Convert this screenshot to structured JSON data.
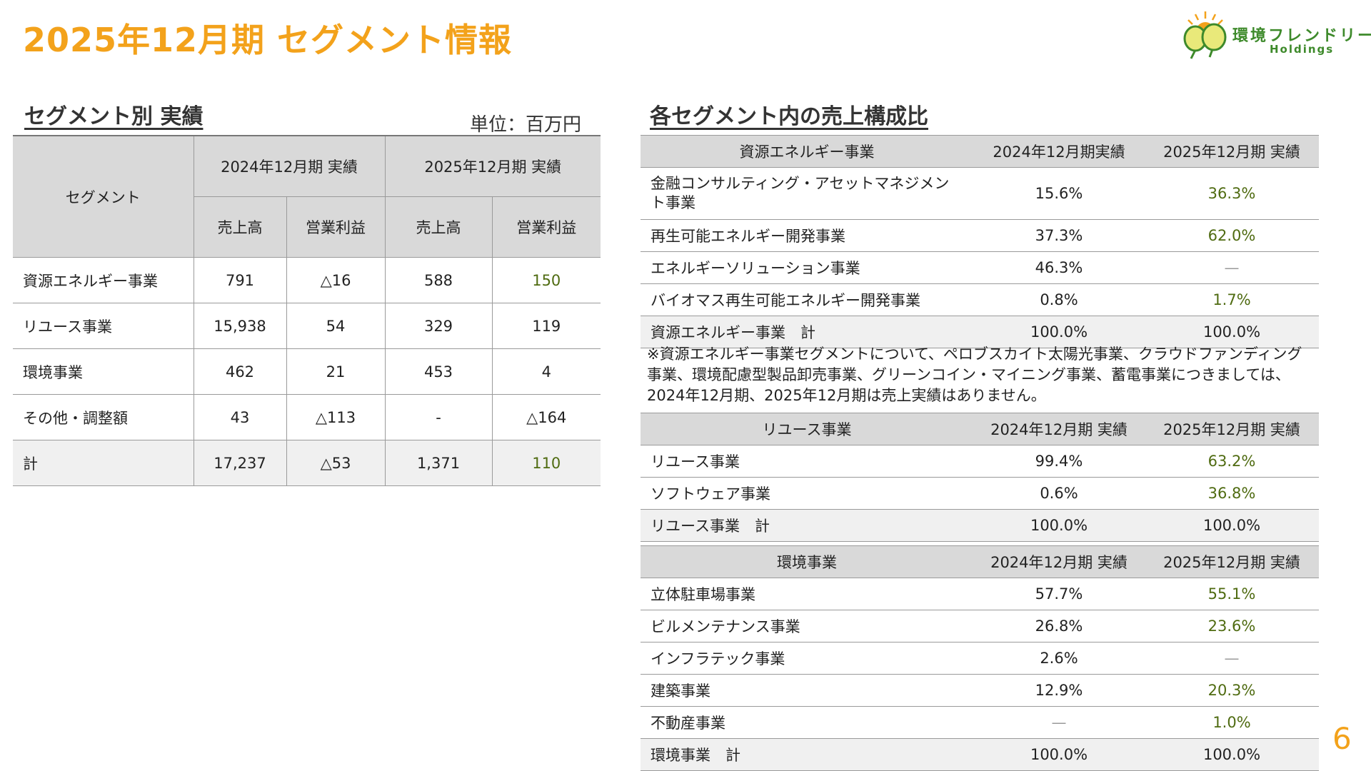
{
  "title": "2025年12月期 セグメント情報",
  "logo": {
    "name": "環境フレンドリー",
    "sub": "Holdings"
  },
  "left": {
    "heading": "セグメント別 実績",
    "unit": "単位：百万円",
    "col_segment": "セグメント",
    "period_2024": "2024年12月期 実績",
    "period_2025": "2025年12月期 実績",
    "sales": "売上高",
    "op_profit": "営業利益",
    "rows": [
      {
        "name": "資源エネルギー事業",
        "s24": "791",
        "p24": "△16",
        "s25": "588",
        "p25": "150"
      },
      {
        "name": "リユース事業",
        "s24": "15,938",
        "p24": "54",
        "s25": "329",
        "p25": "119"
      },
      {
        "name": "環境事業",
        "s24": "462",
        "p24": "21",
        "s25": "453",
        "p25": "4"
      },
      {
        "name": "その他・調整額",
        "s24": "43",
        "p24": "△113",
        "s25": "-",
        "p25": "△164"
      },
      {
        "name": "計",
        "s24": "17,237",
        "p24": "△53",
        "s25": "1,371",
        "p25": "110"
      }
    ]
  },
  "right": {
    "heading": "各セグメント内の売上構成比",
    "energy": {
      "header": [
        "資源エネルギー事業",
        "2024年12月期実績",
        "2025年12月期 実績"
      ],
      "rows": [
        [
          "金融コンサルティング・アセットマネジメント事業",
          "15.6%",
          "36.3%"
        ],
        [
          "再生可能エネルギー開発事業",
          "37.3%",
          "62.0%"
        ],
        [
          "エネルギーソリューション事業",
          "46.3%",
          "—"
        ],
        [
          "バイオマス再生可能エネルギー開発事業",
          "0.8%",
          "1.7%"
        ],
        [
          "資源エネルギー事業　計",
          "100.0%",
          "100.0%"
        ]
      ]
    },
    "note": "※資源エネルギー事業セグメントについて、ペロブスカイト太陽光事業、クラウドファンディング事業、環境配慮型製品卸売事業、グリーンコイン・マイニング事業、蓄電事業につきましては、2024年12月期、2025年12月期は売上実績はありません。",
    "reuse": {
      "header": [
        "リユース事業",
        "2024年12月期 実績",
        "2025年12月期 実績"
      ],
      "rows": [
        [
          "リユース事業",
          "99.4%",
          "63.2%"
        ],
        [
          "ソフトウェア事業",
          "0.6%",
          "36.8%"
        ],
        [
          "リユース事業　計",
          "100.0%",
          "100.0%"
        ]
      ]
    },
    "env": {
      "header": [
        "環境事業",
        "2024年12月期 実績",
        "2025年12月期 実績"
      ],
      "rows": [
        [
          "立体駐車場事業",
          "57.7%",
          "55.1%"
        ],
        [
          "ビルメンテナンス事業",
          "26.8%",
          "23.6%"
        ],
        [
          "インフラテック事業",
          "2.6%",
          "—"
        ],
        [
          "建築事業",
          "12.9%",
          "20.3%"
        ],
        [
          "不動産事業",
          "—",
          "1.0%"
        ],
        [
          "環境事業　計",
          "100.0%",
          "100.0%"
        ]
      ]
    }
  },
  "page_number": "6",
  "colors": {
    "accent": "#f3a21b",
    "green_value": "#4f6b11",
    "header_bg": "#d9d9d9"
  }
}
